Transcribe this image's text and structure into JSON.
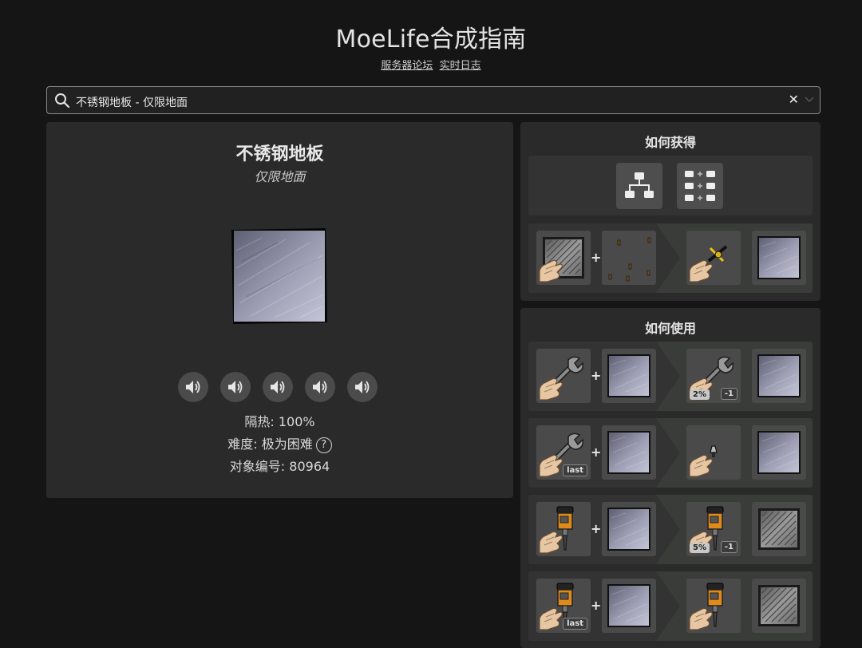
{
  "header": {
    "title": "MoeLife合成指南",
    "links": [
      "服务器论坛",
      "实时日志"
    ]
  },
  "search": {
    "value": "不锈钢地板 - 仅限地面"
  },
  "item": {
    "name": "不锈钢地板",
    "subtitle": "仅限地面",
    "sound_count": 5,
    "props": {
      "insulation": "隔热: 100%",
      "difficulty": "难度: 极为困难",
      "object_id": "对象编号: 80964"
    },
    "help_glyph": "?"
  },
  "obtain": {
    "title": "如何获得",
    "toggles": [
      "tree-icon",
      "grid-recipe-icon"
    ],
    "recipes": [
      {
        "a": "steel-plate-in-hand",
        "b": "rivets",
        "c": "riveted-hand",
        "d": "steel-floor"
      }
    ]
  },
  "use": {
    "title": "如何使用",
    "recipes": [
      {
        "a": "wrench-in-hand",
        "b": "steel-floor",
        "c": "wrench-in-hand",
        "c_badges": [
          "2%",
          "-1"
        ],
        "d": "steel-floor"
      },
      {
        "a": "wrench-in-hand",
        "a_badge": "last",
        "b": "steel-floor",
        "c": "hand-with-nut",
        "d": "steel-floor"
      },
      {
        "a": "jackhammer-in-hand",
        "b": "steel-floor",
        "c": "jackhammer-in-hand",
        "c_badges": [
          "5%",
          "-1"
        ],
        "d": "steel-plate"
      },
      {
        "a": "jackhammer-in-hand",
        "a_badge": "last",
        "b": "steel-floor",
        "c": "jackhammer-in-hand",
        "d": "steel-plate"
      }
    ]
  },
  "colors": {
    "background": "#151515",
    "panel": "#2a2a2a",
    "slot": "#4a4a4a"
  }
}
